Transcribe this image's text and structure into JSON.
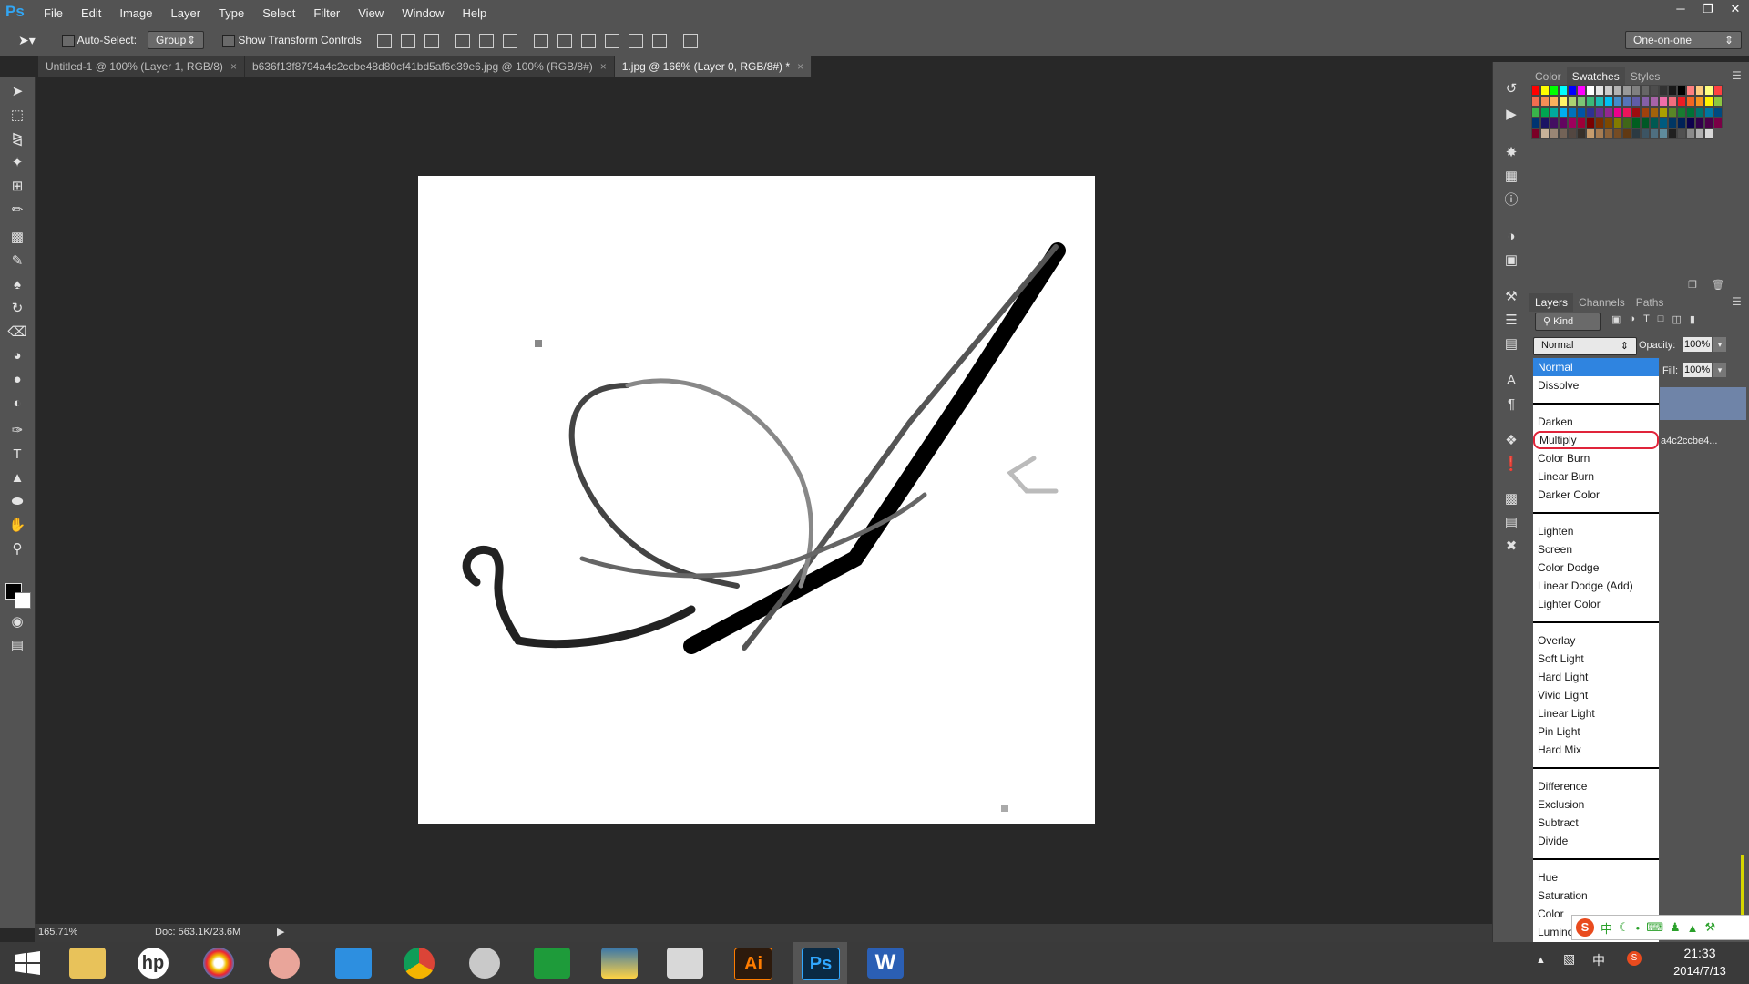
{
  "app": {
    "logo": "Ps"
  },
  "menu": [
    "File",
    "Edit",
    "Image",
    "Layer",
    "Type",
    "Select",
    "Filter",
    "View",
    "Window",
    "Help"
  ],
  "options": {
    "auto_select_label": "Auto-Select:",
    "auto_select_value": "Group",
    "show_transform_label": "Show Transform Controls",
    "workspace": "One-on-one"
  },
  "tabs": [
    {
      "label": "Untitled-1 @ 100% (Layer 1, RGB/8)"
    },
    {
      "label": "b636f13f8794a4c2ccbe48d80cf41bd5af6e39e6.jpg @ 100% (RGB/8#)"
    },
    {
      "label": "1.jpg @ 166% (Layer 0, RGB/8#) *"
    }
  ],
  "status": {
    "zoom": "165.71%",
    "doc": "Doc: 563.1K/23.6M"
  },
  "panels": {
    "top_tabs": [
      "Color",
      "Swatches",
      "Styles"
    ],
    "layer_tabs": [
      "Layers",
      "Channels",
      "Paths"
    ],
    "kind_label": "Kind",
    "blend_mode": "Normal",
    "opacity_label": "Opacity:",
    "opacity_value": "100%",
    "fill_label": "Fill:",
    "fill_value": "100%",
    "layer_name_fragment": "a4c2ccbe4..."
  },
  "blend_modes": {
    "group1": [
      "Normal",
      "Dissolve"
    ],
    "group2": [
      "Darken",
      "Multiply",
      "Color Burn",
      "Linear Burn",
      "Darker Color"
    ],
    "group3": [
      "Lighten",
      "Screen",
      "Color Dodge",
      "Linear Dodge (Add)",
      "Lighter Color"
    ],
    "group4": [
      "Overlay",
      "Soft Light",
      "Hard Light",
      "Vivid Light",
      "Linear Light",
      "Pin Light",
      "Hard Mix"
    ],
    "group5": [
      "Difference",
      "Exclusion",
      "Subtract",
      "Divide"
    ],
    "group6": [
      "Hue",
      "Saturation",
      "Color",
      "Luminosity"
    ]
  },
  "swatch_colors": [
    "#ff0000",
    "#ffff00",
    "#00ff00",
    "#00ffff",
    "#0000ff",
    "#ff00ff",
    "#ffffff",
    "#e6e6e6",
    "#cccccc",
    "#b3b3b3",
    "#999999",
    "#808080",
    "#666666",
    "#4d4d4d",
    "#333333",
    "#1a1a1a",
    "#000000",
    "#ff8080",
    "#ffcc80",
    "#ffff80",
    "#ff4040",
    "#f26c4f",
    "#f68e56",
    "#fbaf5d",
    "#fff568",
    "#acd372",
    "#7cc576",
    "#3bb878",
    "#1abbb4",
    "#00bff3",
    "#438ccb",
    "#5574b9",
    "#605ca8",
    "#855fa8",
    "#a763a8",
    "#f06ea9",
    "#f26d7d",
    "#ed1c24",
    "#f26522",
    "#f7941d",
    "#fff200",
    "#8dc63f",
    "#39b54a",
    "#00a651",
    "#00a99d",
    "#00aeef",
    "#0072bc",
    "#0054a6",
    "#2e3192",
    "#662d91",
    "#92278f",
    "#ec008c",
    "#ed145b",
    "#9e0b0f",
    "#a0410d",
    "#a3620a",
    "#aba000",
    "#598527",
    "#197b30",
    "#007236",
    "#00746b",
    "#0076a3",
    "#004a80",
    "#003471",
    "#1b1464",
    "#440e62",
    "#630460",
    "#9e005d",
    "#9e0039",
    "#790000",
    "#7b2e00",
    "#7d4900",
    "#827b00",
    "#406618",
    "#005e20",
    "#005826",
    "#005952",
    "#005b7f",
    "#003663",
    "#002157",
    "#0d004c",
    "#32004b",
    "#4b0049",
    "#7b0046",
    "#7a0026",
    "#c7b299",
    "#998675",
    "#736357",
    "#534741",
    "#37302a",
    "#c69c6d",
    "#a67c52",
    "#8c6239",
    "#754c24",
    "#603913",
    "#2b3a42",
    "#3c5463",
    "#4f6f80",
    "#5f8b9c",
    "#202020",
    "#505050",
    "#8a8a8a",
    "#b0b0b0",
    "#d8d8d8"
  ],
  "taskbar": {
    "apps": [
      "windows-start",
      "file-explorer",
      "hp",
      "color-app",
      "browser-app",
      "remote-app",
      "chrome",
      "snipping-tool",
      "store",
      "python-app",
      "photo-app",
      "illustrator",
      "photoshop",
      "word"
    ],
    "ai_label": "Ai",
    "ps_label": "Ps",
    "w_label": "W",
    "ime": "中",
    "time": "21:33",
    "date": "2014/7/13"
  }
}
